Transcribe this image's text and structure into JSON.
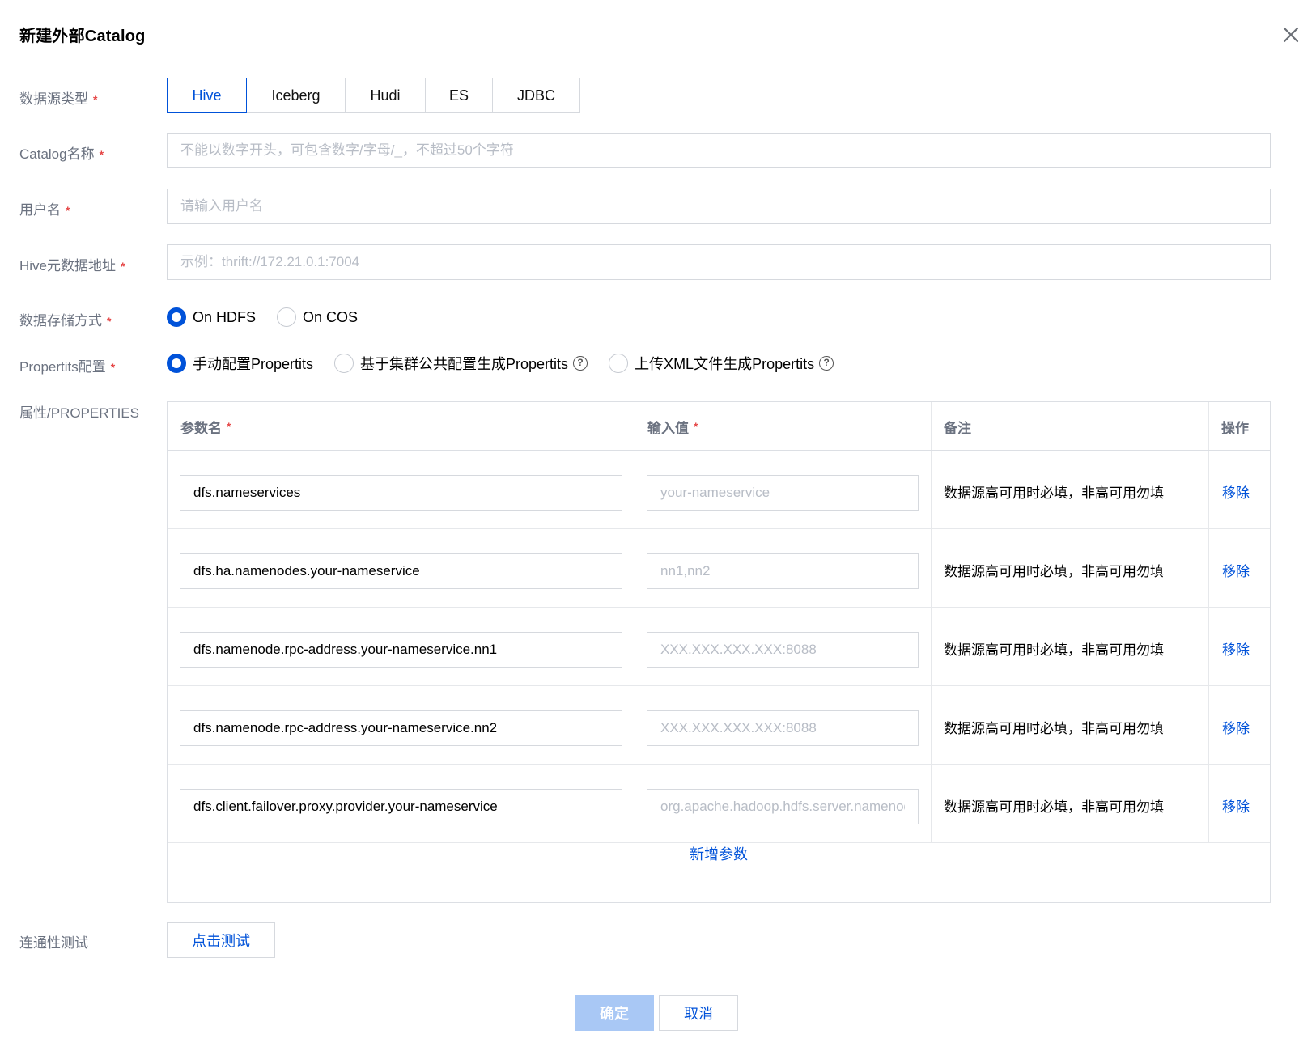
{
  "dialog": {
    "title": "新建外部Catalog"
  },
  "form": {
    "datasource_type": {
      "label": "数据源类型",
      "options": [
        "Hive",
        "Iceberg",
        "Hudi",
        "ES",
        "JDBC"
      ],
      "selected": "Hive"
    },
    "catalog_name": {
      "label": "Catalog名称",
      "placeholder": "不能以数字开头，可包含数字/字母/_，不超过50个字符"
    },
    "username": {
      "label": "用户名",
      "placeholder": "请输入用户名"
    },
    "hive_meta": {
      "label": "Hive元数据地址",
      "placeholder": "示例：thrift://172.21.0.1:7004"
    },
    "storage": {
      "label": "数据存储方式",
      "options": [
        "On HDFS",
        "On COS"
      ],
      "selected": "On HDFS"
    },
    "propertits": {
      "label": "Propertits配置",
      "options": [
        "手动配置Propertits",
        "基于集群公共配置生成Propertits",
        "上传XML文件生成Propertits"
      ],
      "selected": "手动配置Propertits"
    },
    "properties": {
      "label": "属性/PROPERTIES",
      "columns": [
        "参数名",
        "输入值",
        "备注",
        "操作"
      ],
      "rows": [
        {
          "name": "dfs.nameservices",
          "value_placeholder": "your-nameservice",
          "remark": "数据源高可用时必填，非高可用勿填",
          "action": "移除"
        },
        {
          "name": "dfs.ha.namenodes.your-nameservice",
          "value_placeholder": "nn1,nn2",
          "remark": "数据源高可用时必填，非高可用勿填",
          "action": "移除"
        },
        {
          "name": "dfs.namenode.rpc-address.your-nameservice.nn1",
          "value_placeholder": "XXX.XXX.XXX.XXX:8088",
          "remark": "数据源高可用时必填，非高可用勿填",
          "action": "移除"
        },
        {
          "name": "dfs.namenode.rpc-address.your-nameservice.nn2",
          "value_placeholder": "XXX.XXX.XXX.XXX:8088",
          "remark": "数据源高可用时必填，非高可用勿填",
          "action": "移除"
        },
        {
          "name": "dfs.client.failover.proxy.provider.your-nameservice",
          "value_placeholder": "org.apache.hadoop.hdfs.server.namenode.ha.ConfiguredFailoverProxyProvider",
          "remark": "数据源高可用时必填，非高可用勿填",
          "action": "移除"
        }
      ],
      "add_label": "新增参数"
    },
    "connectivity": {
      "label": "连通性测试",
      "button": "点击测试"
    }
  },
  "footer": {
    "confirm": "确定",
    "cancel": "取消"
  },
  "colors": {
    "primary": "#0052d9",
    "primary_disabled": "#a9c8f5",
    "required": "#e54545"
  }
}
